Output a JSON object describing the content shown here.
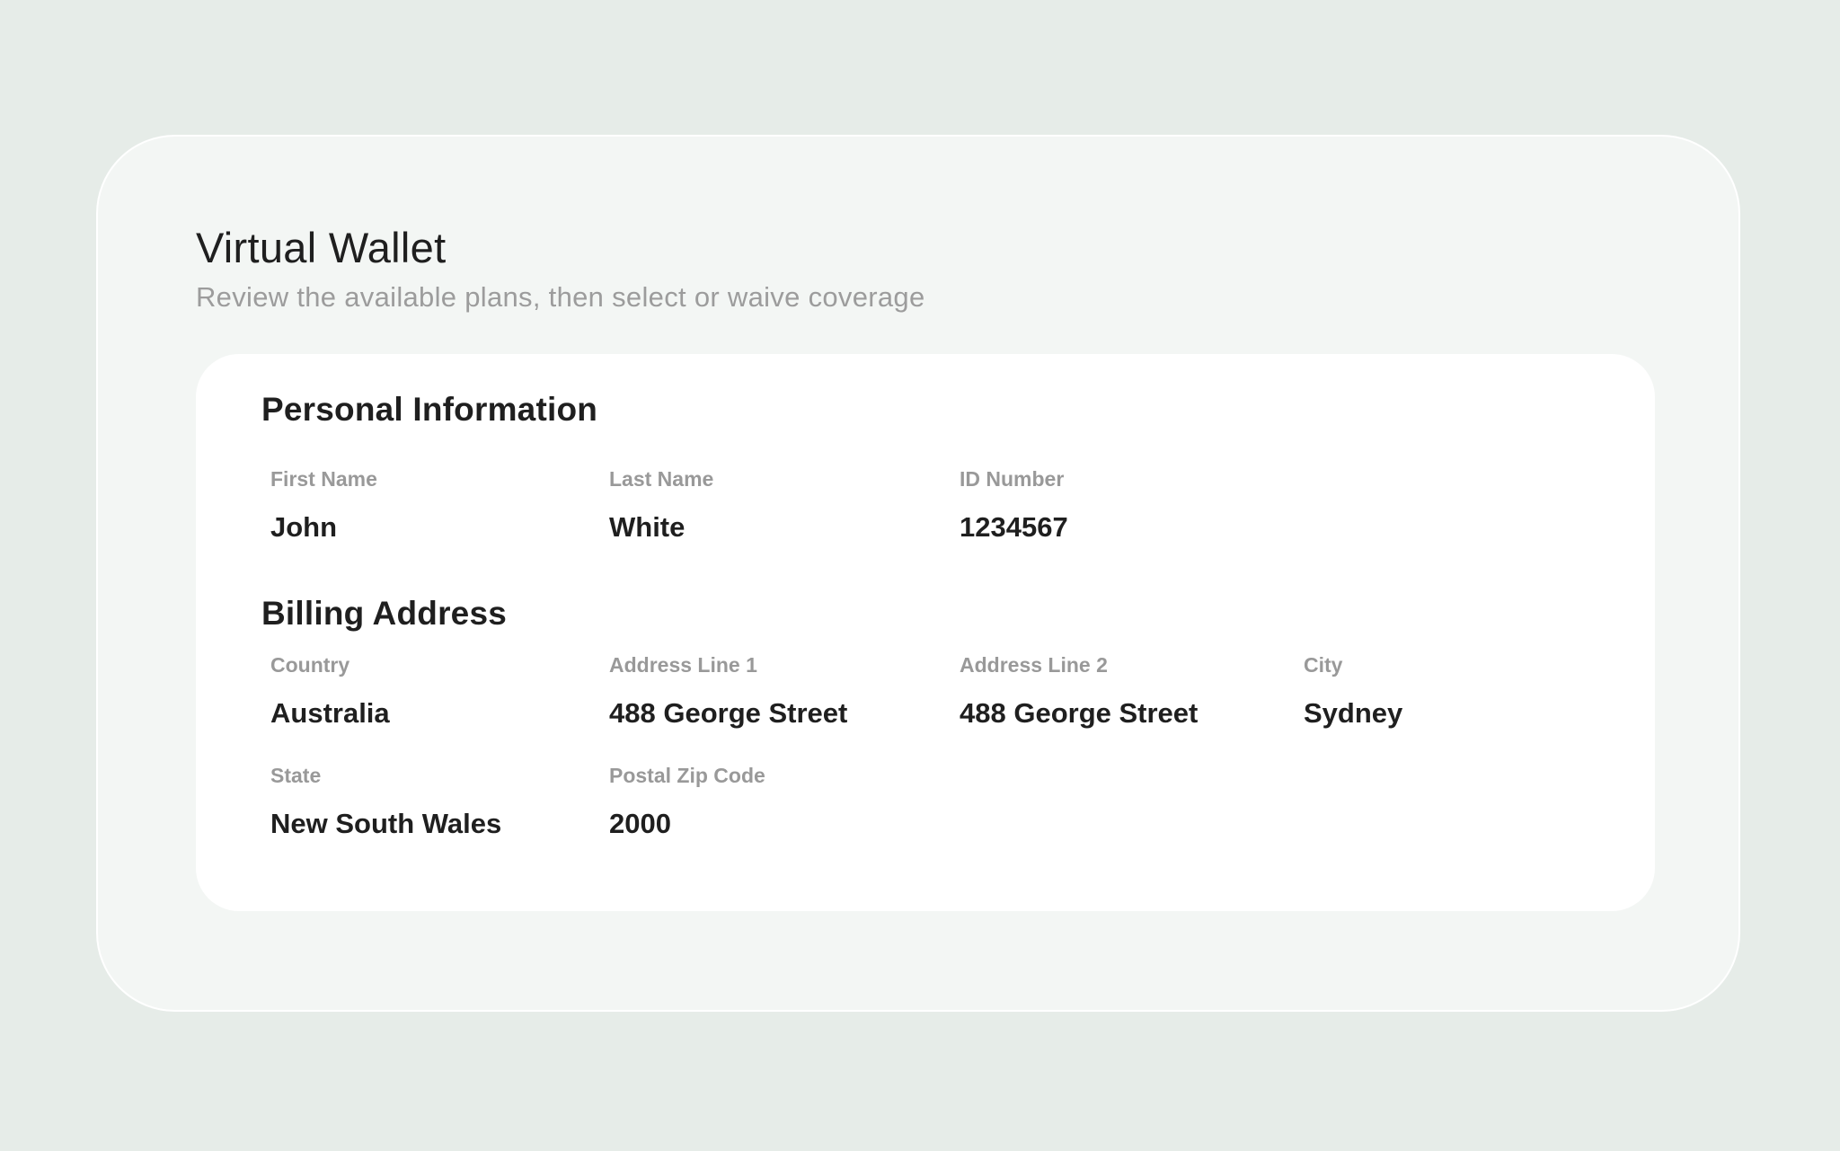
{
  "header": {
    "title": "Virtual Wallet",
    "subtitle": "Review the available plans, then select or waive coverage"
  },
  "personal_information": {
    "title": "Personal Information",
    "fields": {
      "first_name": {
        "label": "First Name",
        "value": "John"
      },
      "last_name": {
        "label": "Last Name",
        "value": "White"
      },
      "id_number": {
        "label": "ID Number",
        "value": "1234567"
      }
    }
  },
  "billing_address": {
    "title": "Billing Address",
    "fields": {
      "country": {
        "label": "Country",
        "value": "Australia"
      },
      "address_line_1": {
        "label": "Address Line 1",
        "value": "488 George Street"
      },
      "address_line_2": {
        "label": "Address Line 2",
        "value": "488 George Street"
      },
      "city": {
        "label": "City",
        "value": "Sydney"
      },
      "state": {
        "label": "State",
        "value": "New South Wales"
      },
      "postal_zip_code": {
        "label": "Postal Zip Code",
        "value": "2000"
      }
    }
  },
  "colors": {
    "page_background": "#e6ece8",
    "outer_card_background": "#f3f6f4",
    "inner_card_background": "#ffffff",
    "text_primary": "#1f1f1f",
    "text_muted": "#999999"
  }
}
